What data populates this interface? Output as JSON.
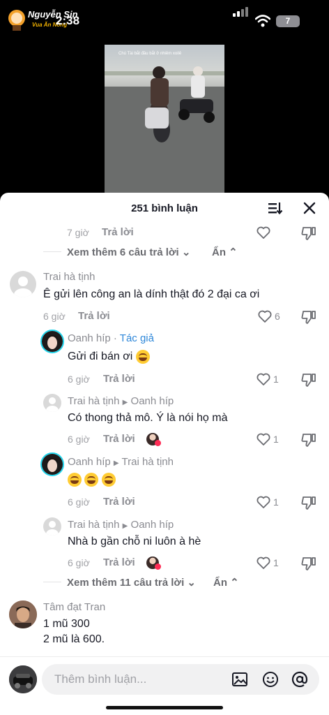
{
  "status": {
    "time": "2:38",
    "battery": "7",
    "logo_name": "Nguyễn Sin",
    "logo_sub": "Vua Ăn Nông"
  },
  "video": {
    "caption": "Chú Tài bắt đầu bắt ở nhiêm xoilê"
  },
  "header": {
    "title": "251 bình luận"
  },
  "comments_top": {
    "time": "7 giờ",
    "reply": "Trả lời"
  },
  "more1": {
    "label": "Xem thêm 6 câu trả lời",
    "hide": "Ẩn"
  },
  "c1": {
    "name": "Trai hà tịnh",
    "text": "Ê gửi lên công an là dính thật đó 2 đại ca ơi",
    "time": "6 giờ",
    "reply": "Trả lời",
    "likes": "6"
  },
  "r1": {
    "name": "Oanh híp",
    "author": "Tác giả",
    "sep": " · ",
    "text": "Gửi đi bán ơi",
    "time": "6 giờ",
    "reply": "Trả lời",
    "likes": "1"
  },
  "r2": {
    "name": "Trai hà tịnh",
    "to": "Oanh híp",
    "text": "Có thong thả mô. Ý là nói họ mà",
    "time": "6 giờ",
    "reply": "Trả lời",
    "likes": "1"
  },
  "r3": {
    "name": "Oanh híp",
    "to": "Trai hà tịnh",
    "time": "6 giờ",
    "reply": "Trả lời",
    "likes": "1"
  },
  "r4": {
    "name": "Trai hà tịnh",
    "to": "Oanh híp",
    "text": "Nhà b gần chỗ ni luôn à hè",
    "time": "6 giờ",
    "reply": "Trả lời",
    "likes": "1"
  },
  "more2": {
    "label": "Xem thêm 11 câu trả lời",
    "hide": "Ẩn"
  },
  "c2": {
    "name": "Tâm đạt Tran",
    "line1": "1 mũ 300",
    "line2": "2 mũ là 600."
  },
  "composer": {
    "placeholder": "Thêm bình luận..."
  },
  "colors": {
    "author_tag": "#2e87d9",
    "accent": "#fe2c55",
    "story_ring": "#20d5ec"
  }
}
